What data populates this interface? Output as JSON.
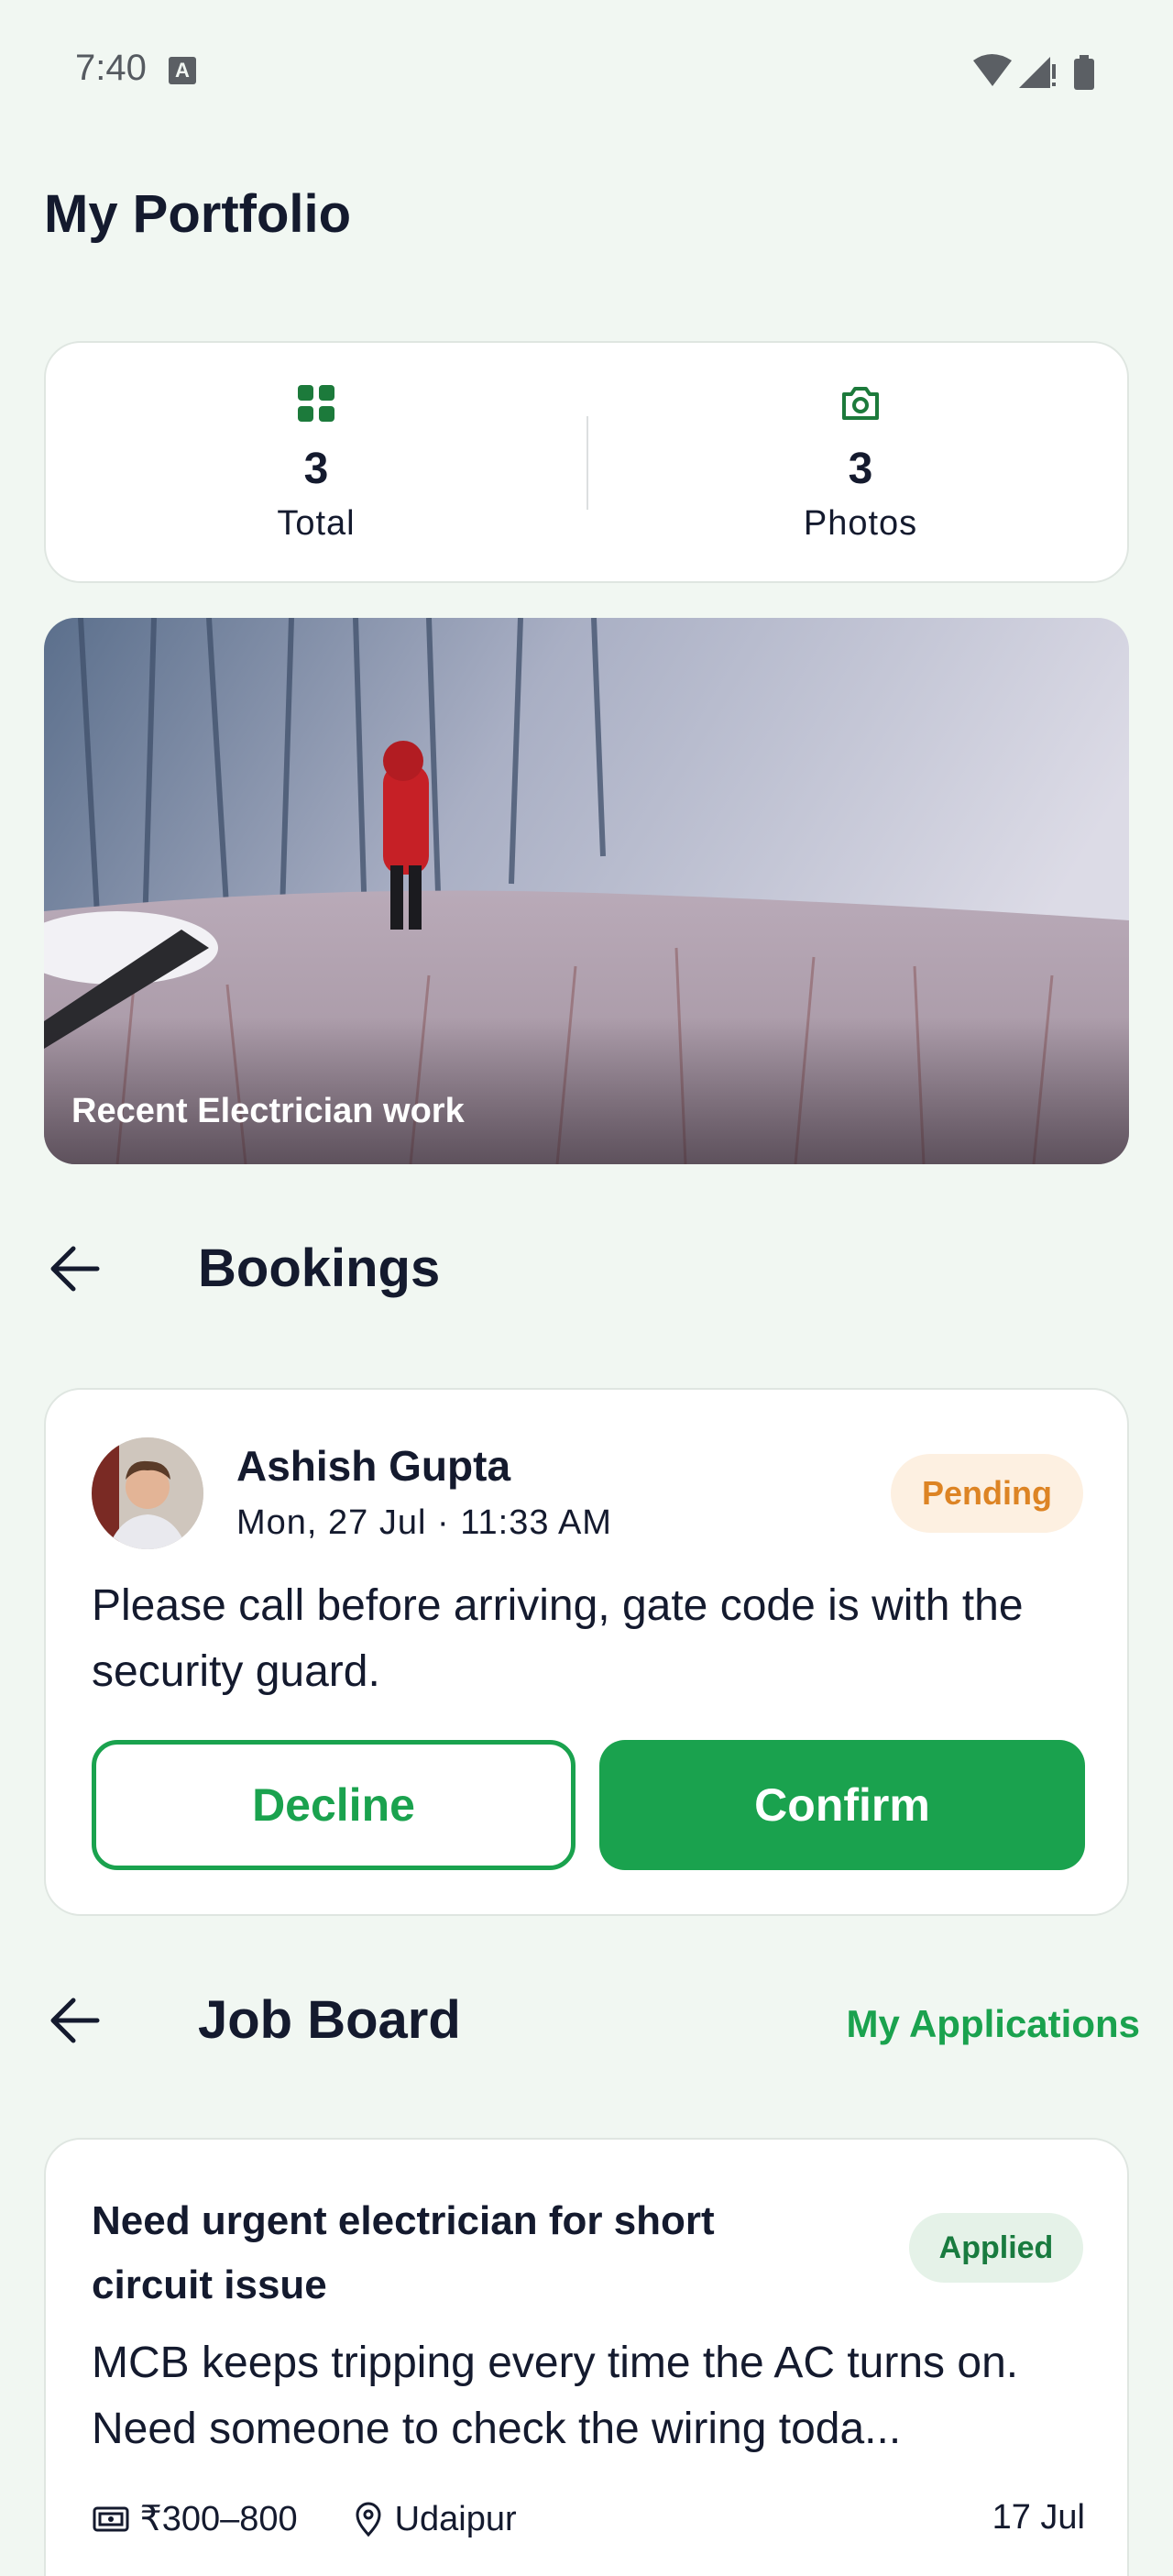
{
  "status_bar": {
    "time": "7:40",
    "badge": "A"
  },
  "header": {
    "title": "My Portfolio"
  },
  "stats": [
    {
      "icon": "grid-icon",
      "value": "3",
      "label": "Total"
    },
    {
      "icon": "camera-icon",
      "value": "3",
      "label": "Photos"
    }
  ],
  "portfolio_photo": {
    "caption": "Recent Electrician work"
  },
  "bookings_section": {
    "title": "Bookings"
  },
  "booking": {
    "name": "Ashish Gupta",
    "datetime": "Mon, 27 Jul · 11:33 AM",
    "status": "Pending",
    "note": "Please call before arriving, gate code is with the security guard.",
    "decline_label": "Decline",
    "confirm_label": "Confirm"
  },
  "job_board_section": {
    "title": "Job Board",
    "link": "My Applications"
  },
  "job": {
    "title": "Need urgent electrician for short circuit issue",
    "status": "Applied",
    "description": "MCB keeps tripping every time the AC turns on. Need someone to check the wiring toda...",
    "price": "₹300–800",
    "location": "Udaipur",
    "date": "17 Jul"
  },
  "colors": {
    "accent": "#1aa24e",
    "pending": "#dd8424",
    "background": "#f1f7f2"
  }
}
